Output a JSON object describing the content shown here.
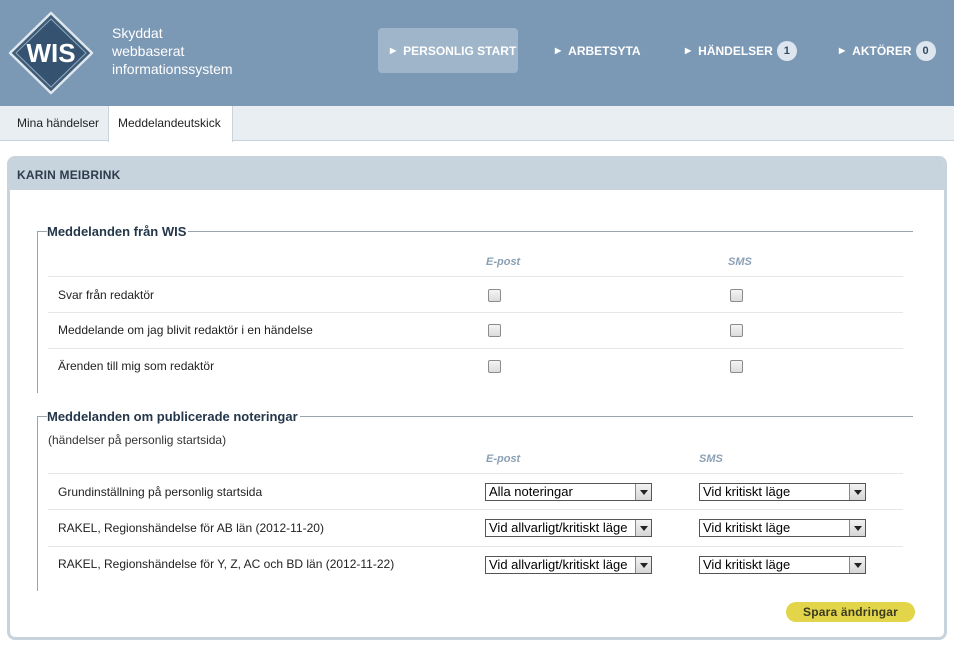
{
  "header": {
    "logo_text": "WIS",
    "tagline": [
      "Skyddat",
      "webbaserat",
      "informationssystem"
    ],
    "nav": [
      {
        "label": "PERSONLIG START",
        "active": true
      },
      {
        "label": "ARBETSYTA"
      },
      {
        "label": "HÄNDELSER",
        "badge": "1"
      },
      {
        "label": "AKTÖRER",
        "badge": "0"
      }
    ]
  },
  "tabs": [
    "Mina händelser",
    "Meddelandeutskick"
  ],
  "panel": {
    "title": "KARIN MEIBRINK",
    "section1": {
      "legend": "Meddelanden från WIS",
      "col_email": "E-post",
      "col_sms": "SMS",
      "rows": [
        {
          "label": "Svar från redaktör",
          "email": false,
          "sms": false
        },
        {
          "label": "Meddelande om jag blivit redaktör i en händelse",
          "email": false,
          "sms": false
        },
        {
          "label": "Ärenden till mig som redaktör",
          "email": false,
          "sms": false
        }
      ]
    },
    "section2": {
      "legend": "Meddelanden om publicerade noteringar",
      "note": "(händelser på personlig startsida)",
      "col_email": "E-post",
      "col_sms": "SMS",
      "rows": [
        {
          "label": "Grundinställning på personlig startsida",
          "email": "Alla noteringar",
          "sms": "Vid kritiskt läge"
        },
        {
          "label": "RAKEL, Regionshändelse för AB län (2012-11-20)",
          "email": "Vid allvarligt/kritiskt läge",
          "sms": "Vid kritiskt läge"
        },
        {
          "label": "RAKEL, Regionshändelse för Y, Z, AC och BD län (2012-11-22)",
          "email": "Vid allvarligt/kritiskt läge",
          "sms": "Vid kritiskt läge"
        }
      ]
    },
    "save_label": "Spara ändringar"
  },
  "colors": {
    "header_bg": "#7b98b4",
    "accent_button": "#e2d54a",
    "panel_border": "#c7d3dd"
  }
}
